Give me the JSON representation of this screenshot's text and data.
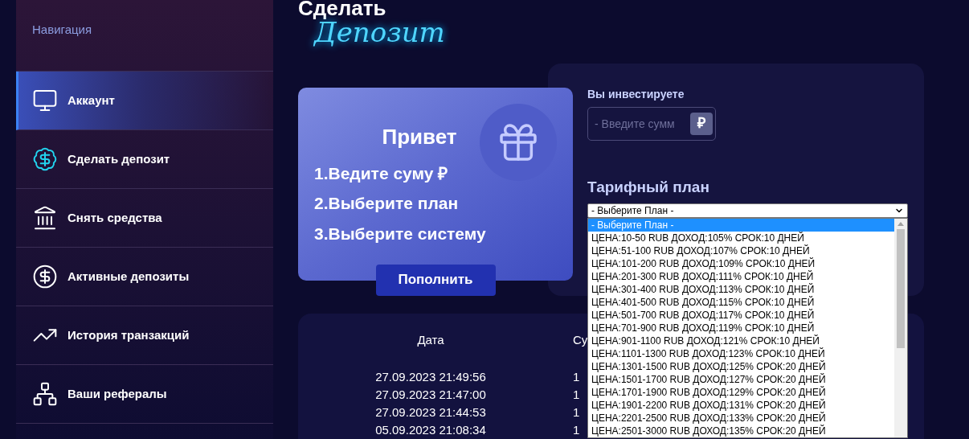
{
  "sidebar": {
    "heading": "Навигация",
    "items": [
      {
        "label": "Аккаунт",
        "selected": true
      },
      {
        "label": "Сделать депозит",
        "selected": false
      },
      {
        "label": "Снять средства",
        "selected": false
      },
      {
        "label": "Активные депозиты",
        "selected": false
      },
      {
        "label": "История транзакций",
        "selected": false
      },
      {
        "label": "Ваши рефералы",
        "selected": false
      }
    ]
  },
  "page_title": {
    "line1": "Сделать",
    "line2": "Депозит"
  },
  "promo_card": {
    "title": "Привет",
    "steps": [
      "1.Ведите суму ₽",
      "2.Выберите план",
      "3.Выберите систему"
    ],
    "button": "Пополнить"
  },
  "invest_form": {
    "amount_label": "Вы инвестируете",
    "amount_placeholder": "- Введите сумм",
    "currency": "₽",
    "plan_label": "Тарифный план",
    "plan_select": {
      "value": "- Выберите План -",
      "expanded": true,
      "options": [
        {
          "label": "- Выберите План -",
          "selected": true
        },
        {
          "label": "ЦЕНА:10-50 RUB ДОХОД:105% СРОК:10 ДНЕЙ",
          "selected": false
        },
        {
          "label": "ЦЕНА:51-100 RUB ДОХОД:107% СРОК:10 ДНЕЙ",
          "selected": false
        },
        {
          "label": "ЦЕНА:101-200 RUB ДОХОД:109% СРОК:10 ДНЕЙ",
          "selected": false
        },
        {
          "label": "ЦЕНА:201-300 RUB ДОХОД:111% СРОК:10 ДНЕЙ",
          "selected": false
        },
        {
          "label": "ЦЕНА:301-400 RUB ДОХОД:113% СРОК:10 ДНЕЙ",
          "selected": false
        },
        {
          "label": "ЦЕНА:401-500 RUB ДОХОД:115% СРОК:10 ДНЕЙ",
          "selected": false
        },
        {
          "label": "ЦЕНА:501-700 RUB ДОХОД:117% СРОК:10 ДНЕЙ",
          "selected": false
        },
        {
          "label": "ЦЕНА:701-900 RUB ДОХОД:119% СРОК:10 ДНЕЙ",
          "selected": false
        },
        {
          "label": "ЦЕНА:901-1100 RUB ДОХОД:121% СРОК:10 ДНЕЙ",
          "selected": false
        },
        {
          "label": "ЦЕНА:1101-1300 RUB ДОХОД:123% СРОК:10 ДНЕЙ",
          "selected": false
        },
        {
          "label": "ЦЕНА:1301-1500 RUB ДОХОД:125% СРОК:20 ДНЕЙ",
          "selected": false
        },
        {
          "label": "ЦЕНА:1501-1700 RUB ДОХОД:127% СРОК:20 ДНЕЙ",
          "selected": false
        },
        {
          "label": "ЦЕНА:1701-1900 RUB ДОХОД:129% СРОК:20 ДНЕЙ",
          "selected": false
        },
        {
          "label": "ЦЕНА:1901-2200 RUB ДОХОД:131% СРОК:20 ДНЕЙ",
          "selected": false
        },
        {
          "label": "ЦЕНА:2201-2500 RUB ДОХОД:133% СРОК:20 ДНЕЙ",
          "selected": false
        },
        {
          "label": "ЦЕНА:2501-3000 RUB ДОХОД:135% СРОК:20 ДНЕЙ",
          "selected": false
        }
      ]
    }
  },
  "history_table": {
    "columns": [
      "Дата",
      "Су"
    ],
    "rows": [
      [
        "27.09.2023 21:49:56",
        "1"
      ],
      [
        "27.09.2023 21:47:00",
        "1"
      ],
      [
        "27.09.2023 21:44:53",
        "1"
      ],
      [
        "05.09.2023 21:08:34",
        "1"
      ]
    ]
  }
}
